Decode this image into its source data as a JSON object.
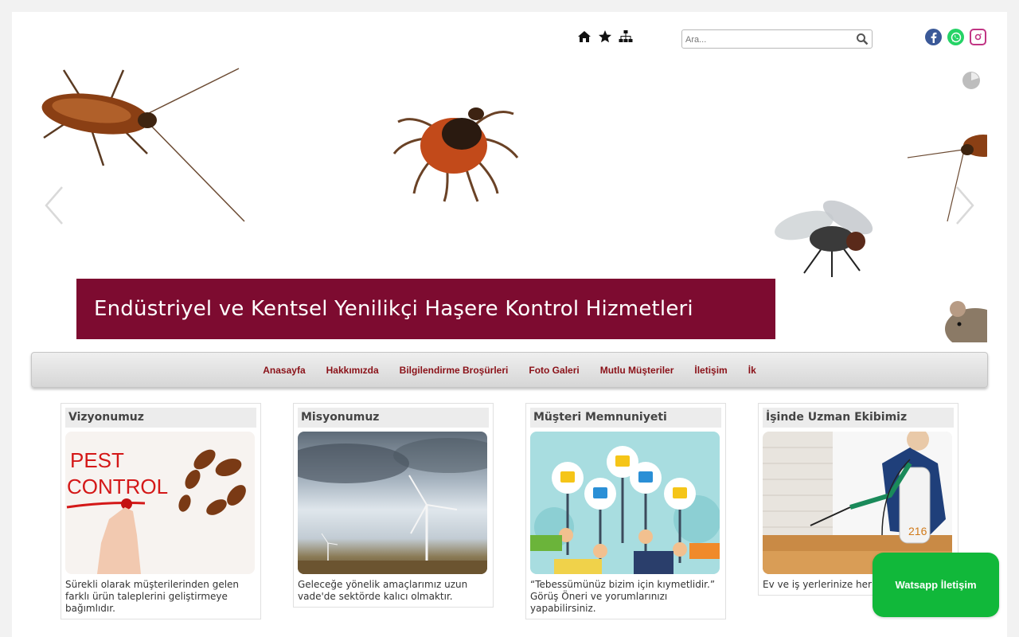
{
  "header": {
    "icons": [
      "home-icon",
      "star-icon",
      "sitemap-icon"
    ],
    "search": {
      "placeholder": "Ara...",
      "value": ""
    },
    "social": [
      {
        "name": "facebook-icon",
        "color": "#3b5998"
      },
      {
        "name": "whatsapp-icon",
        "color": "#25d366"
      },
      {
        "name": "instagram-icon",
        "color": "#c13584"
      }
    ]
  },
  "slider": {
    "banner_text": "Endüstriyel ve Kentsel Yenilikçi Haşere Kontrol Hizmetleri",
    "banner_color": "#7d0b30"
  },
  "nav": {
    "items": [
      "Anasayfa",
      "Hakkımızda",
      "Bilgilendirme Broşürleri",
      "Foto Galeri",
      "Mutlu Müşteriler",
      "İletişim",
      "İk"
    ]
  },
  "cards": [
    {
      "title": "Vizyonumuz",
      "image_text": [
        "PEST",
        "CONTROL"
      ],
      "text": "Sürekli olarak müşterilerinden gelen farklı ürün taleplerini geliştirmeye bağımlıdır."
    },
    {
      "title": "Misyonumuz",
      "text": "Geleceğe yönelik amaçlarımız uzun vade'de sektörde kalıcı olmaktır."
    },
    {
      "title": "Müşteri Memnuniyeti",
      "text": "“Tebessümünüz bizim için kıymetlidir.” Görüş Öneri ve yorumlarınızı yapabilirsiniz."
    },
    {
      "title": "İşinde Uzman Ekibimiz",
      "text": "Ev ve iş yerlerinize her satışımız vardır."
    }
  ],
  "whatsapp_button": {
    "label": "Watsapp İletişim",
    "color": "#11b83a"
  }
}
